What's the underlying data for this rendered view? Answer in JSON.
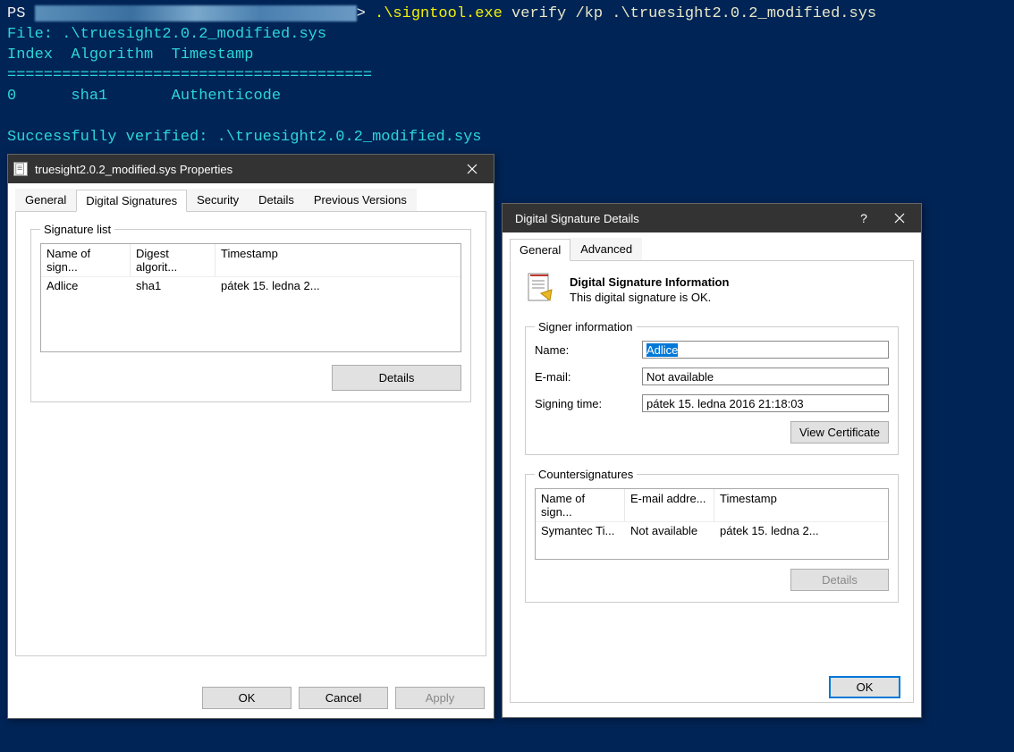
{
  "terminal": {
    "prompt_ps": "PS ",
    "prompt_gt": "> ",
    "cmd": ".\\signtool.exe",
    "args": " verify /kp .\\truesight2.0.2_modified.sys",
    "line_file": "File: .\\truesight2.0.2_modified.sys",
    "line_hdr": "Index  Algorithm  Timestamp",
    "line_sep": "========================================",
    "line_row": "0      sha1       Authenticode",
    "line_ok": "Successfully verified: .\\truesight2.0.2_modified.sys"
  },
  "props": {
    "title": "truesight2.0.2_modified.sys Properties",
    "tabs": [
      "General",
      "Digital Signatures",
      "Security",
      "Details",
      "Previous Versions"
    ],
    "sig_group_title": "Signature list",
    "sig_cols": [
      "Name of sign...",
      "Digest algorit...",
      "Timestamp"
    ],
    "sig_row": [
      "Adlice",
      "sha1",
      "pátek 15. ledna 2..."
    ],
    "details_btn": "Details",
    "ok": "OK",
    "cancel": "Cancel",
    "apply": "Apply"
  },
  "det": {
    "title": "Digital Signature Details",
    "tabs": [
      "General",
      "Advanced"
    ],
    "info_heading": "Digital Signature Information",
    "info_msg": "This digital signature is OK.",
    "signer_group": "Signer information",
    "name_label": "Name:",
    "name_val": "Adlice",
    "email_label": "E-mail:",
    "email_val": "Not available",
    "time_label": "Signing time:",
    "time_val": "pátek 15. ledna 2016 21:18:03",
    "view_cert": "View Certificate",
    "cs_group": "Countersignatures",
    "cs_cols": [
      "Name of sign...",
      "E-mail addre...",
      "Timestamp"
    ],
    "cs_row": [
      "Symantec Ti...",
      "Not available",
      "pátek 15. ledna 2..."
    ],
    "details_btn": "Details",
    "ok": "OK"
  }
}
